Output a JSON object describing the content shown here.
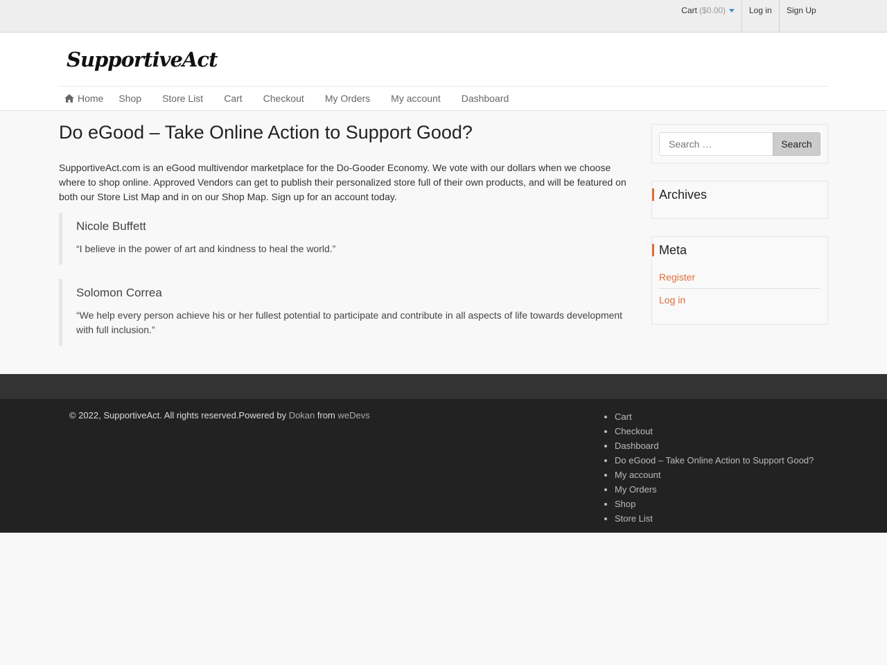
{
  "topbar": {
    "cart_label": "Cart",
    "cart_amount": "($0.00)",
    "login_label": "Log in",
    "signup_label": "Sign Up"
  },
  "header": {
    "logo_text": "SupportiveAct"
  },
  "nav": {
    "items": [
      "Home",
      "Shop",
      "Store List",
      "Cart",
      "Checkout",
      "My Orders",
      "My account",
      "Dashboard"
    ]
  },
  "main": {
    "title": "Do eGood – Take Online Action to Support Good?",
    "intro": "SupportiveAct.com is an eGood multivendor marketplace for the Do-Gooder Economy. We vote with our dollars when we choose where to shop online. Approved Vendors can get to publish their personalized store full of their own products, and will be featured on both our Store List Map and in on our Shop Map. Sign up for an account today.",
    "quotes": [
      {
        "name": "Nicole Buffett",
        "text": "“I believe in the power of art and kindness to heal the world.”"
      },
      {
        "name": "Solomon Correa",
        "text": "“We help every person achieve his or her fullest potential to participate and contribute in all aspects of life towards development with full inclusion.”"
      }
    ]
  },
  "sidebar": {
    "search_placeholder": "Search …",
    "search_button": "Search",
    "archives_title": "Archives",
    "meta_title": "Meta",
    "meta_links": [
      "Register",
      "Log in"
    ]
  },
  "footer": {
    "copyright": "© 2022, SupportiveAct. All rights reserved.Powered by ",
    "dokan": "Dokan",
    "from": " from ",
    "wedevs": "weDevs",
    "links": [
      "Cart",
      "Checkout",
      "Dashboard",
      "Do eGood – Take Online Action to Support Good?",
      "My account",
      "My Orders",
      "Shop",
      "Store List"
    ]
  },
  "colors": {
    "accent": "#e06d3a",
    "caret": "#3b8dbd",
    "footer_bg": "#222222"
  }
}
